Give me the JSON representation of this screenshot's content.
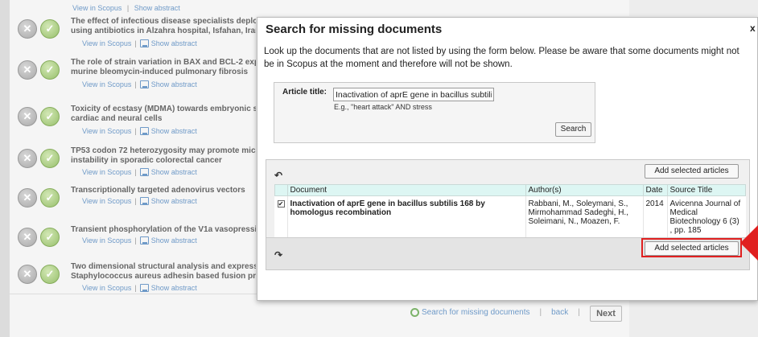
{
  "background": {
    "top_links": {
      "scopus": "View in Scopus",
      "abstract": "Show abstract"
    },
    "rows": [
      {
        "title": "The effect of infectious disease specialists deployme… using antibiotics in Alzahra hospital, Isfahan, Iran",
        "line1": "The effect of infectious disease specialists deployme",
        "line2": "using antibiotics in Alzahra hospital, Isfahan, Iran",
        "scopus": "View in Scopus",
        "abstract": "Show abstract"
      },
      {
        "line1": "The role of strain variation in BAX and BCL-2 expres",
        "line2": "murine bleomycin-induced pulmonary fibrosis",
        "scopus": "View in Scopus",
        "abstract": "Show abstract"
      },
      {
        "line1": "Toxicity of ecstasy (MDMA) towards embryonic sten",
        "line2": "cardiac and neural cells",
        "scopus": "View in Scopus",
        "abstract": "Show abstract"
      },
      {
        "line1": "TP53 codon 72 heterozygosity may promote microsa",
        "line2": "instability in sporadic colorectal cancer",
        "scopus": "View in Scopus",
        "abstract": "Show abstract"
      },
      {
        "line1": "Transcriptionally targeted adenovirus vectors",
        "line2": "",
        "scopus": "View in Scopus",
        "abstract": "Show abstract"
      },
      {
        "line1": "Transient phosphorylation of the V1a vasopressin re",
        "line2": "",
        "scopus": "View in Scopus",
        "abstract": "Show abstract"
      },
      {
        "line1": "Two dimensional structural analysis and expression",
        "line2": "Staphylococcus aureus adhesin based fusion protei",
        "scopus": "View in Scopus",
        "abstract": "Show abstract"
      }
    ],
    "footer": {
      "search_missing": "Search for missing documents",
      "back": "back",
      "next": "Next",
      "sep": "|"
    }
  },
  "modal": {
    "title": "Search for missing documents",
    "close": "x",
    "intro": "Look up the documents that are not listed by using the form below. Please be aware that some documents might not be in Scopus at the moment and therefore will not be shown.",
    "form": {
      "label": "Article title:",
      "value": "Inactivation of aprE gene in bacillus subtilis",
      "hint": "E.g., \"heart attack\" AND stress",
      "search_button": "Search"
    },
    "results": {
      "add_button": "Add selected articles",
      "columns": [
        "Document",
        "Author(s)",
        "Date",
        "Source Title"
      ],
      "row": {
        "checked": "✔",
        "document": "Inactivation of aprE gene in bacillus subtilis 168 by homologus recombination",
        "authors": "Rabbani, M., Soleymani, S., Mirmohammad Sadeghi, H., Soleimani, N., Moazen, F.",
        "date": "2014",
        "source": "Avicenna Journal of Medical Biotechnology 6 (3) , pp. 185"
      }
    }
  },
  "colors": {
    "highlight": "#e02020",
    "link": "#6f9ac8",
    "table_header": "#ddf6f3"
  }
}
